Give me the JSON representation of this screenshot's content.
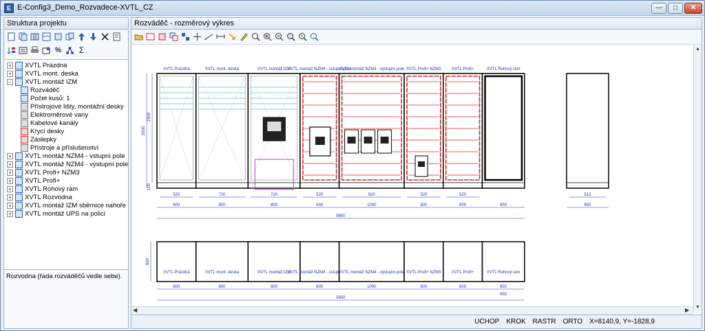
{
  "window": {
    "title": "E-Config3_Demo_Rozvadece-XVTL_CZ",
    "icon": "app-icon",
    "controls": [
      "—",
      "□",
      "✕"
    ]
  },
  "left_panel": {
    "title": "Struktura projektu",
    "tree": [
      {
        "label": "XVTL Prázdná",
        "expand": "+",
        "level": 0
      },
      {
        "label": "XVTL mont. deska",
        "expand": "+",
        "level": 0
      },
      {
        "label": "XVTL montáž IZM",
        "expand": "−",
        "level": 0
      },
      {
        "label": "Rozváděč",
        "expand": "",
        "level": 1
      },
      {
        "label": "Počet kusů: 1",
        "expand": "",
        "level": 1
      },
      {
        "label": "Přístrojové lišty, montážní desky",
        "expand": "",
        "level": 1
      },
      {
        "label": "Elektroměrové vany",
        "expand": "",
        "level": 1
      },
      {
        "label": "Kabelové kanály",
        "expand": "",
        "level": 1
      },
      {
        "label": "Krycí desky",
        "expand": "",
        "level": 1
      },
      {
        "label": "Záslepky",
        "expand": "",
        "level": 1
      },
      {
        "label": "Přístroje a příslušenství",
        "expand": "",
        "level": 1
      },
      {
        "label": "XVTL montáž NZM4 - vstupní pole",
        "expand": "+",
        "level": 0
      },
      {
        "label": "XVTL montáž NZM4 - výstupní pole",
        "expand": "+",
        "level": 0
      },
      {
        "label": "XVTL Profi+ NZM3",
        "expand": "+",
        "level": 0
      },
      {
        "label": "XVTL Profi+",
        "expand": "+",
        "level": 0
      },
      {
        "label": "XVTL Rohový rám",
        "expand": "+",
        "level": 0
      },
      {
        "label": "XVTL Rozvodna",
        "expand": "+",
        "level": 0
      },
      {
        "label": "XVTL montáž IZM sběrnice nahoře",
        "expand": "+",
        "level": 0
      },
      {
        "label": "XVTL montáž UPS na polici",
        "expand": "+",
        "level": 0
      }
    ],
    "description": "Rozvodna (řada rozváděčů vedle sebe)."
  },
  "right_panel": {
    "title": "Rozváděč - rozměrový výkres"
  },
  "drawing": {
    "front_labels": [
      "XVTL Prázdná",
      "XVTL mont. deska",
      "XVTL montáž IZM",
      "XVTL montáž NZM4 - vstupní pole",
      "XVTL montáž NZM4 - výstupní pole",
      "XVTL Profi+ NZM3",
      "XVTL Profi+",
      "XVTL Rohový rám"
    ],
    "inner_widths": [
      "520",
      "720",
      "720",
      "520",
      "920",
      "520",
      "520"
    ],
    "outer_widths": [
      "600",
      "800",
      "800",
      "600",
      "1000",
      "600",
      "600",
      "650"
    ],
    "total": "5650",
    "side_inner": "512",
    "side_outer": "650",
    "heights": [
      "2000",
      "1900",
      "100"
    ],
    "plan_depth": "600",
    "plan_labels": [
      "XVTL Prázdná",
      "XVTL mont. deska",
      "XVTL montáž IZM",
      "XVTL montáž NZM4 - vstupní pole",
      "XVTL montáž NZM4 - výstupní pole",
      "XVTL Profi+ NZM3",
      "XVTL Profi+",
      "XVTL Rohový rám"
    ],
    "plan_widths": [
      "600",
      "800",
      "800",
      "600",
      "1000",
      "600",
      "600",
      "650"
    ],
    "plan_total": "5650",
    "plan_extra": "650"
  },
  "status": {
    "uchop": "UCHOP",
    "krok": "KROK",
    "rastr": "RASTR",
    "orto": "ORTO",
    "coords": "X=8140,9, Y=-1828,9"
  }
}
